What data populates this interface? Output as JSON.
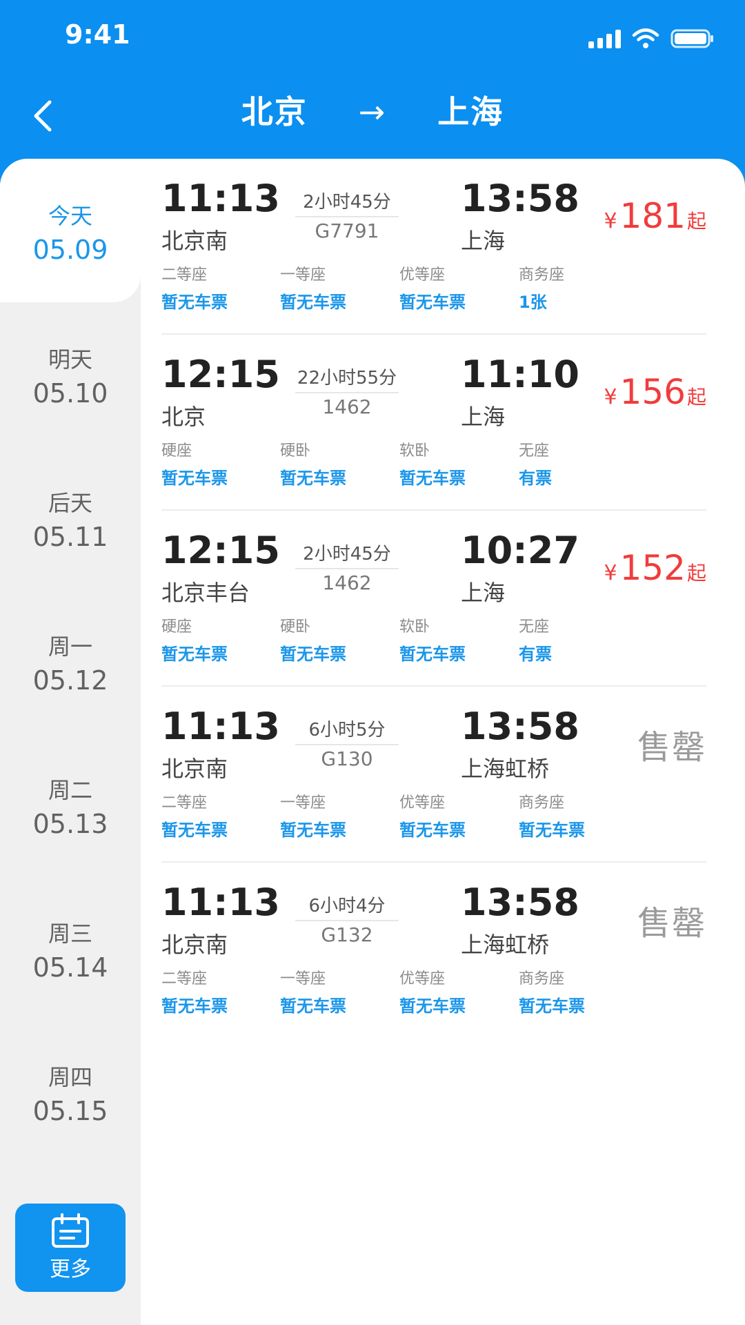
{
  "status": {
    "time": "9:41"
  },
  "header": {
    "from": "北京",
    "arrow": "→",
    "to": "上海"
  },
  "dates": [
    {
      "label": "今天",
      "date": "05.09",
      "active": true
    },
    {
      "label": "明天",
      "date": "05.10"
    },
    {
      "label": "后天",
      "date": "05.11"
    },
    {
      "label": "周一",
      "date": "05.12"
    },
    {
      "label": "周二",
      "date": "05.13"
    },
    {
      "label": "周三",
      "date": "05.14"
    },
    {
      "label": "周四",
      "date": "05.15"
    }
  ],
  "more": {
    "label": "更多"
  },
  "trains": [
    {
      "dep_time": "11:13",
      "dep_station": "北京南",
      "duration": "2小时45分",
      "train_no": "G7791",
      "arr_time": "13:58",
      "arr_station": "上海",
      "price": {
        "symbol": "¥",
        "amount": "181",
        "suffix": "起"
      },
      "seats": [
        {
          "name": "二等座",
          "avail": "暂无车票"
        },
        {
          "name": "一等座",
          "avail": "暂无车票"
        },
        {
          "name": "优等座",
          "avail": "暂无车票"
        },
        {
          "name": "商务座",
          "avail": "1张"
        }
      ]
    },
    {
      "dep_time": "12:15",
      "dep_station": "北京",
      "duration": "22小时55分",
      "train_no": "1462",
      "arr_time": "11:10",
      "arr_station": "上海",
      "price": {
        "symbol": "¥",
        "amount": "156",
        "suffix": "起"
      },
      "seats": [
        {
          "name": "硬座",
          "avail": "暂无车票"
        },
        {
          "name": "硬卧",
          "avail": "暂无车票"
        },
        {
          "name": "软卧",
          "avail": "暂无车票"
        },
        {
          "name": "无座",
          "avail": "有票"
        }
      ]
    },
    {
      "dep_time": "12:15",
      "dep_station": "北京丰台",
      "duration": "2小时45分",
      "train_no": "1462",
      "arr_time": "10:27",
      "arr_station": "上海",
      "price": {
        "symbol": "¥",
        "amount": "152",
        "suffix": "起"
      },
      "seats": [
        {
          "name": "硬座",
          "avail": "暂无车票"
        },
        {
          "name": "硬卧",
          "avail": "暂无车票"
        },
        {
          "name": "软卧",
          "avail": "暂无车票"
        },
        {
          "name": "无座",
          "avail": "有票"
        }
      ]
    },
    {
      "dep_time": "11:13",
      "dep_station": "北京南",
      "duration": "6小时5分",
      "train_no": "G130",
      "arr_time": "13:58",
      "arr_station": "上海虹桥",
      "soldout": "售罄",
      "seats": [
        {
          "name": "二等座",
          "avail": "暂无车票"
        },
        {
          "name": "一等座",
          "avail": "暂无车票"
        },
        {
          "name": "优等座",
          "avail": "暂无车票"
        },
        {
          "name": "商务座",
          "avail": "暂无车票"
        }
      ]
    },
    {
      "dep_time": "11:13",
      "dep_station": "北京南",
      "duration": "6小时4分",
      "train_no": "G132",
      "arr_time": "13:58",
      "arr_station": "上海虹桥",
      "soldout": "售罄",
      "seats": [
        {
          "name": "二等座",
          "avail": "暂无车票"
        },
        {
          "name": "一等座",
          "avail": "暂无车票"
        },
        {
          "name": "优等座",
          "avail": "暂无车票"
        },
        {
          "name": "商务座",
          "avail": "暂无车票"
        }
      ]
    }
  ],
  "colors": {
    "primary": "#0b8ff0",
    "price": "#f23b3b",
    "avail": "#1a96ea"
  }
}
